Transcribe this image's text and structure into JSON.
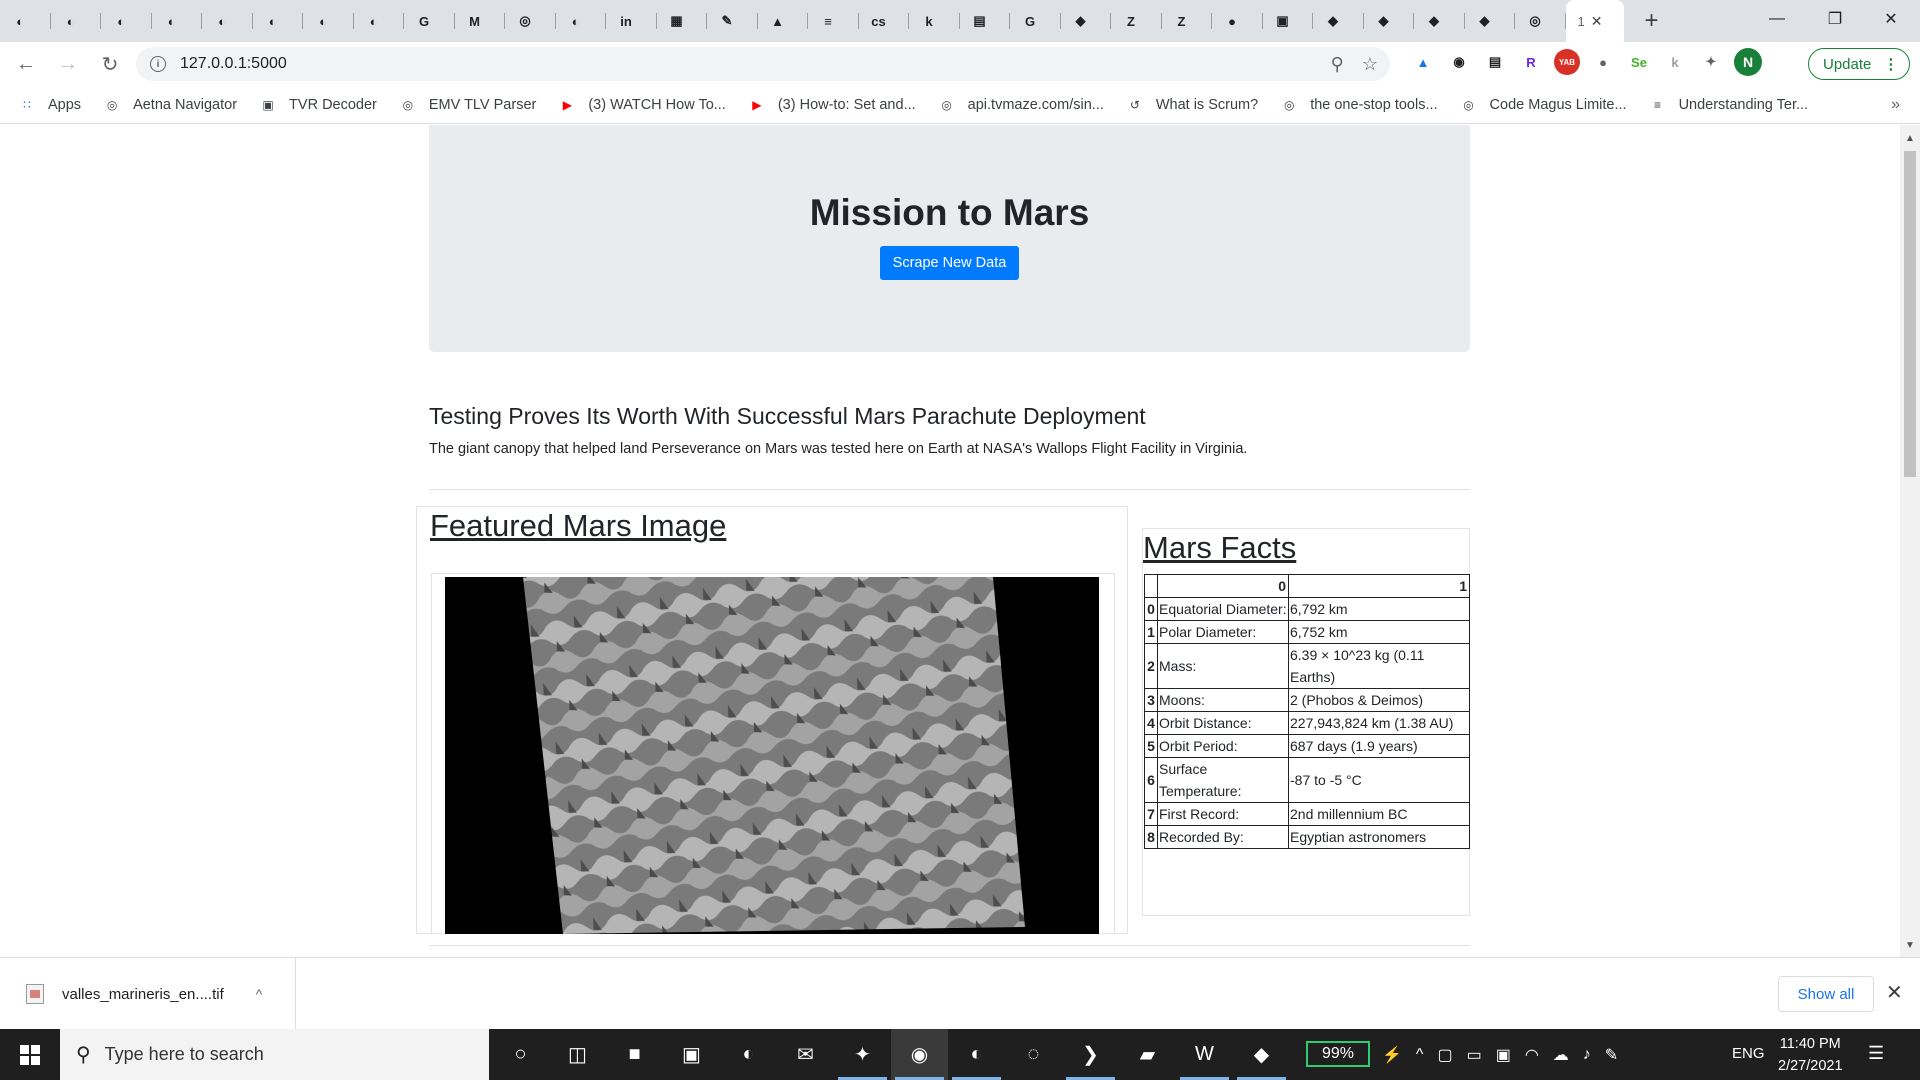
{
  "browser": {
    "tabs_pinned": [
      {
        "icon": "github-icon",
        "glyph": "◐"
      },
      {
        "icon": "github-icon",
        "glyph": "◐"
      },
      {
        "icon": "github-icon",
        "glyph": "◐"
      },
      {
        "icon": "github-icon",
        "glyph": "◐"
      },
      {
        "icon": "github-icon",
        "glyph": "◐"
      },
      {
        "icon": "github-icon",
        "glyph": "◐"
      },
      {
        "icon": "github-icon",
        "glyph": "◐"
      },
      {
        "icon": "github-icon",
        "glyph": "◐"
      },
      {
        "icon": "google-translate-icon",
        "glyph": "G"
      },
      {
        "icon": "gmail-icon",
        "glyph": "M"
      },
      {
        "icon": "globe-icon",
        "glyph": "◎"
      },
      {
        "icon": "github-icon",
        "glyph": "◐"
      },
      {
        "icon": "linkedin-icon",
        "glyph": "in"
      },
      {
        "icon": "chequered-icon",
        "glyph": "▦"
      },
      {
        "icon": "edit-icon",
        "glyph": "✎"
      },
      {
        "icon": "google-drive-icon",
        "glyph": "▲"
      },
      {
        "icon": "google-docs-icon",
        "glyph": "≡"
      },
      {
        "icon": "cs-icon",
        "glyph": "cs"
      },
      {
        "icon": "k-icon",
        "glyph": "k"
      },
      {
        "icon": "clapper-icon",
        "glyph": "▤"
      },
      {
        "icon": "google-icon",
        "glyph": "G"
      },
      {
        "icon": "gitlab-icon",
        "glyph": "◆"
      },
      {
        "icon": "zendesk-icon",
        "glyph": "Z"
      },
      {
        "icon": "zendesk-icon",
        "glyph": "Z"
      },
      {
        "icon": "circle-dark-icon",
        "glyph": "●"
      },
      {
        "icon": "image-thumb-icon",
        "glyph": "▣"
      },
      {
        "icon": "gitlab-icon",
        "glyph": "◆"
      },
      {
        "icon": "gitlab-icon",
        "glyph": "◆"
      },
      {
        "icon": "gitlab-icon",
        "glyph": "◆"
      },
      {
        "icon": "gitlab-icon",
        "glyph": "◆"
      },
      {
        "icon": "globe-icon",
        "glyph": "◎"
      }
    ],
    "active_tab": {
      "title": "1",
      "close": "✕"
    },
    "new_tab": "+",
    "window": {
      "minimize": "—",
      "maximize": "❐",
      "close": "✕"
    },
    "address": {
      "url": "127.0.0.1:5000"
    },
    "update_label": "Update",
    "profile_initial": "N",
    "extensions": [
      {
        "icon": "google-drive-icon",
        "glyph": "▲",
        "color": "#1a73e8"
      },
      {
        "icon": "audio-icon",
        "glyph": "◉",
        "color": "#202124"
      },
      {
        "icon": "clapper-icon",
        "glyph": "▤",
        "color": "#202124"
      },
      {
        "icon": "r-icon",
        "glyph": "R",
        "color": "#6d28d9"
      },
      {
        "icon": "yab-icon",
        "glyph": "YAB",
        "color": "#d93025"
      },
      {
        "icon": "circle-icon",
        "glyph": "●",
        "color": "#5f6368"
      },
      {
        "icon": "selenium-icon",
        "glyph": "Se",
        "color": "#43b02a"
      },
      {
        "icon": "k-ext-icon",
        "glyph": "k",
        "color": "#9aa0a6"
      },
      {
        "icon": "puzzle-icon",
        "glyph": "✦",
        "color": "#5f6368"
      }
    ],
    "bookmarks": [
      {
        "icon": "apps-grid-icon",
        "glyph": "∷",
        "label": "Apps"
      },
      {
        "icon": "globe-icon",
        "glyph": "◎",
        "label": "Aetna Navigator"
      },
      {
        "icon": "tvr-icon",
        "glyph": "▣",
        "label": "TVR Decoder"
      },
      {
        "icon": "globe-icon",
        "glyph": "◎",
        "label": "EMV TLV Parser"
      },
      {
        "icon": "youtube-icon",
        "glyph": "▶",
        "label": "(3) WATCH How To..."
      },
      {
        "icon": "youtube-icon",
        "glyph": "▶",
        "label": "(3) How-to: Set and..."
      },
      {
        "icon": "globe-icon",
        "glyph": "◎",
        "label": "api.tvmaze.com/sin..."
      },
      {
        "icon": "scrum-icon",
        "glyph": "↺",
        "label": "What is Scrum?"
      },
      {
        "icon": "globe-icon",
        "glyph": "◎",
        "label": "the one-stop tools..."
      },
      {
        "icon": "globe-icon",
        "glyph": "◎",
        "label": "Code Magus Limite..."
      },
      {
        "icon": "document-icon",
        "glyph": "≡",
        "label": "Understanding Ter..."
      }
    ],
    "bookmarks_more": "»"
  },
  "page": {
    "title": "Mission to Mars",
    "scrape_button": "Scrape New Data",
    "news_title": "Testing Proves Its Worth With Successful Mars Parachute Deployment",
    "news_paragraph": "The giant canopy that helped land Perseverance on Mars was tested here on Earth at NASA's Wallops Flight Facility in Virginia.",
    "featured_heading": "Featured Mars Image",
    "facts_heading": "Mars Facts",
    "facts_table": {
      "columns": [
        "",
        "0",
        "1"
      ],
      "rows": [
        {
          "index": "0",
          "label": "Equatorial Diameter:",
          "value": "6,792 km"
        },
        {
          "index": "1",
          "label": "Polar Diameter:",
          "value": "6,752 km"
        },
        {
          "index": "2",
          "label": "Mass:",
          "value": "6.39 × 10^23 kg (0.11 Earths)"
        },
        {
          "index": "3",
          "label": "Moons:",
          "value": "2 (Phobos & Deimos)"
        },
        {
          "index": "4",
          "label": "Orbit Distance:",
          "value": "227,943,824 km (1.38 AU)"
        },
        {
          "index": "5",
          "label": "Orbit Period:",
          "value": "687 days (1.9 years)"
        },
        {
          "index": "6",
          "label": "Surface Temperature:",
          "value": "-87 to -5 °C"
        },
        {
          "index": "7",
          "label": "First Record:",
          "value": "2nd millennium BC"
        },
        {
          "index": "8",
          "label": "Recorded By:",
          "value": "Egyptian astronomers"
        }
      ]
    }
  },
  "downloads": {
    "file_name": "valles_marineris_en....tif",
    "show_all": "Show all",
    "chevron": "^",
    "close": "✕"
  },
  "taskbar": {
    "search_placeholder": "Type here to search",
    "battery": "99%",
    "language": "ENG",
    "time": "11:40 PM",
    "date": "2/27/2021",
    "apps": [
      {
        "icon": "cortana-icon",
        "glyph": "○",
        "running": false
      },
      {
        "icon": "task-view-icon",
        "glyph": "◫",
        "running": false
      },
      {
        "icon": "file-explorer-icon",
        "glyph": "■",
        "running": false
      },
      {
        "icon": "store-icon",
        "glyph": "▣",
        "running": false
      },
      {
        "icon": "edge-icon",
        "glyph": "◐",
        "running": false
      },
      {
        "icon": "mail-icon",
        "glyph": "✉",
        "running": false
      },
      {
        "icon": "slack-icon",
        "glyph": "✦",
        "running": true
      },
      {
        "icon": "chrome-icon",
        "glyph": "◉",
        "running": true,
        "focus": true
      },
      {
        "icon": "github-desktop-icon",
        "glyph": "◐",
        "running": true
      },
      {
        "icon": "refresh-app-icon",
        "glyph": "◌",
        "running": false
      },
      {
        "icon": "vscode-icon",
        "glyph": "❯",
        "running": true
      },
      {
        "icon": "notes-app-icon",
        "glyph": "▰",
        "running": false
      },
      {
        "icon": "word-icon",
        "glyph": "W",
        "running": true
      },
      {
        "icon": "mongodb-compass-icon",
        "glyph": "◆",
        "running": true
      }
    ],
    "tray_icons": [
      {
        "icon": "power-plug-icon",
        "glyph": "⚡"
      },
      {
        "icon": "chevron-up-icon",
        "glyph": "^"
      },
      {
        "icon": "meet-now-icon",
        "glyph": "▢"
      },
      {
        "icon": "battery-icon",
        "glyph": "▭"
      },
      {
        "icon": "screen-icon",
        "glyph": "▣"
      },
      {
        "icon": "wifi-icon",
        "glyph": "◠"
      },
      {
        "icon": "cloud-icon",
        "glyph": "☁"
      },
      {
        "icon": "volume-icon",
        "glyph": "♪"
      },
      {
        "icon": "pen-icon",
        "glyph": "✎"
      }
    ],
    "notification_glyph": "☰"
  },
  "colors": {
    "primary_button": "#007bff",
    "jumbotron_bg": "#e9ecef",
    "taskbar_bg": "#1f1f1f",
    "battery_border": "#2ecc71"
  }
}
